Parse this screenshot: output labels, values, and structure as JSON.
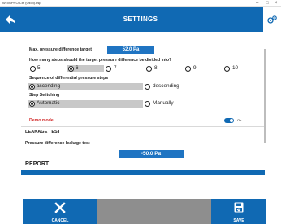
{
  "window": {
    "title": "WTM-PRO-Ctrl (OEM).bsp",
    "minimize": "–",
    "maximize": "□",
    "close": "×"
  },
  "header": {
    "title": "SETTINGS"
  },
  "content": {
    "target_label": "Max. pressure difference target",
    "target_value": "52.0 Pa",
    "steps_question": "How many steps should the target pressure difference be divided into?",
    "steps_options": [
      "5",
      "6",
      "7",
      "8",
      "9",
      "10"
    ],
    "steps_selected": "6",
    "sequence_label": "Sequence of differential pressure steps",
    "sequence_options": [
      "ascending",
      "descending"
    ],
    "sequence_selected": "ascending",
    "switching_label": "Step Switching",
    "switching_options": [
      "Automatic",
      "Manually"
    ],
    "switching_selected": "Automatic",
    "demo_label": "Demo mode",
    "demo_state": "On",
    "leakage_heading": "LEAKAGE TEST",
    "leakage_label": "Pressure difference leakage test",
    "leakage_value": "-50.0 Pa",
    "report_heading": "REPORT"
  },
  "footer": {
    "cancel_label": "CANCEL",
    "save_label": "SAVE"
  },
  "colors": {
    "accent": "#1069b3",
    "value_box": "#1f74c2",
    "demo_red": "#d32f2f",
    "footer_gray": "#8e8e8e"
  },
  "icons": {
    "back": "back-arrow-icon",
    "settings": "settings-gears-icon",
    "cancel": "x-icon",
    "save": "floppy-disk-icon"
  }
}
